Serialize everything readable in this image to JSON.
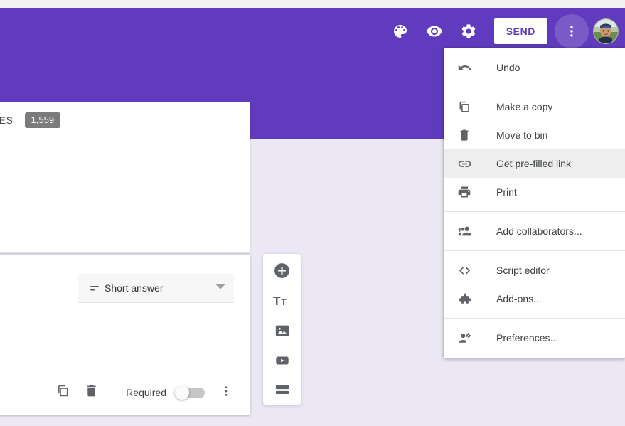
{
  "theme": {
    "brand_purple": "#613bbd",
    "page_background": "#ebe7f4",
    "menu_highlight": "#eeeeee",
    "badge_grey": "#7b7b7b"
  },
  "top_strip": {
    "clipped_text": " "
  },
  "header": {
    "icons": [
      {
        "name": "palette-icon",
        "title": "Customise theme"
      },
      {
        "name": "eye-icon",
        "title": "Preview"
      },
      {
        "name": "gear-icon",
        "title": "Settings"
      }
    ],
    "send_label": "SEND",
    "more_button": {
      "name": "more-vert-icon",
      "title": "More"
    },
    "avatar": {
      "name": "avatar",
      "title": "Account"
    }
  },
  "tabs": {
    "responses_label": "NSES",
    "responses_count": "1,559"
  },
  "question": {
    "type_label": "Short answer",
    "type_icon": "short-answer-icon",
    "dropdown_icon": "chevron-down-icon",
    "footer": {
      "duplicate_icon": "duplicate-icon",
      "delete_icon": "trash-icon",
      "required_label": "Required",
      "required_on": false,
      "more_icon": "more-vert-icon"
    }
  },
  "add_toolbar": {
    "items": [
      {
        "name": "add-question-icon",
        "title": "Add question"
      },
      {
        "name": "add-title-icon",
        "title": "Add title and description"
      },
      {
        "name": "add-image-icon",
        "title": "Add image"
      },
      {
        "name": "add-video-icon",
        "title": "Add video"
      },
      {
        "name": "add-section-icon",
        "title": "Add section"
      }
    ]
  },
  "menu": {
    "groups": [
      {
        "items": [
          {
            "label": "Undo",
            "icon": "undo-icon",
            "highlighted": false
          }
        ]
      },
      {
        "items": [
          {
            "label": "Make a copy",
            "icon": "copy-icon",
            "highlighted": false
          },
          {
            "label": "Move to bin",
            "icon": "trash-icon",
            "highlighted": false
          },
          {
            "label": "Get pre-filled link",
            "icon": "link-icon",
            "highlighted": true
          },
          {
            "label": "Print",
            "icon": "print-icon",
            "highlighted": false
          }
        ]
      },
      {
        "items": [
          {
            "label": "Add collaborators...",
            "icon": "add-people-icon",
            "highlighted": false
          }
        ]
      },
      {
        "items": [
          {
            "label": "Script editor",
            "icon": "code-icon",
            "highlighted": false
          },
          {
            "label": "Add-ons...",
            "icon": "puzzle-icon",
            "highlighted": false
          }
        ]
      },
      {
        "items": [
          {
            "label": "Preferences...",
            "icon": "person-settings-icon",
            "highlighted": false
          }
        ]
      }
    ]
  }
}
